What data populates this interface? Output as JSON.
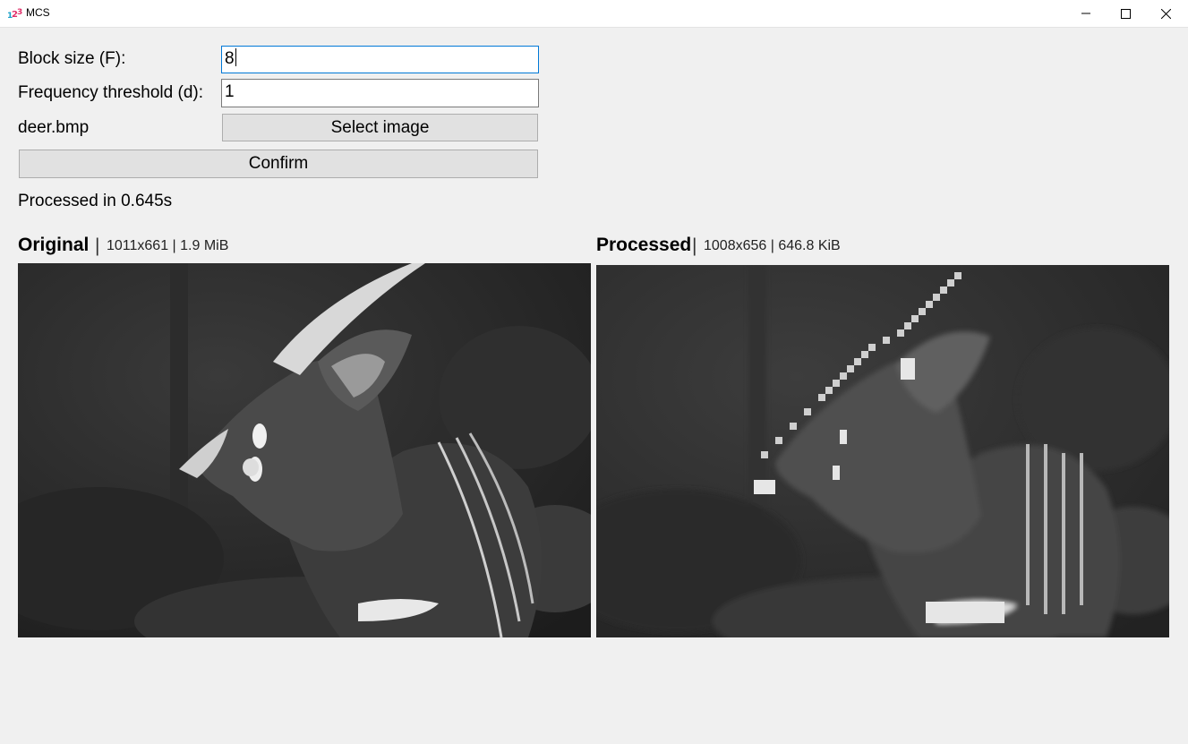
{
  "window": {
    "title": "MCS",
    "app_icon": "123-icon",
    "controls": [
      "minimize-icon",
      "maximize-icon",
      "close-icon"
    ]
  },
  "form": {
    "block_size_label": "Block size (F):",
    "block_size_value": "8",
    "freq_label": "Frequency threshold (d):",
    "freq_value": "1",
    "file_name": "deer.bmp",
    "select_image_label": "Select image",
    "confirm_label": "Confirm"
  },
  "status": {
    "text": "Processed in 0.645s"
  },
  "original": {
    "title": "Original",
    "separator": "|",
    "meta": "1011x661 | 1.9 MiB"
  },
  "processed": {
    "title": "Processed",
    "separator": "|",
    "meta": "1008x656 | 646.8 KiB"
  },
  "colors": {
    "focus": "#0078d7",
    "background": "#f0f0f0",
    "button": "#e1e1e1"
  }
}
